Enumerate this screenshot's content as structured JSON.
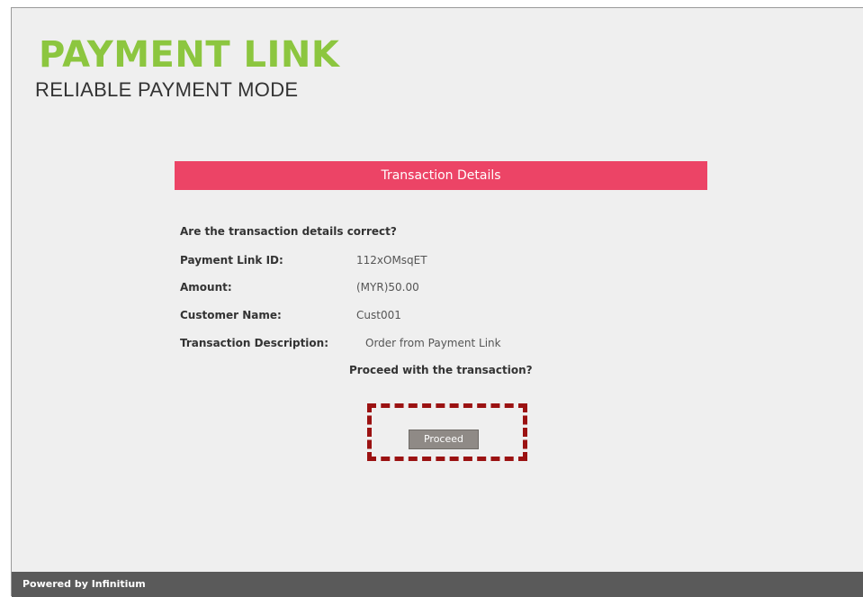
{
  "colors": {
    "brand_green": "#8cc63f",
    "header_pink": "#ec4466",
    "highlight_red": "#9b1212",
    "footer_gray": "#5a5a5a",
    "background": "#efefef"
  },
  "brand": {
    "title": "PAYMENT LINK",
    "subtitle": "RELIABLE PAYMENT MODE"
  },
  "transaction": {
    "header": "Transaction Details",
    "question": "Are the transaction details correct?",
    "rows": [
      {
        "label": "Payment Link ID:",
        "value": "112xOMsqET"
      },
      {
        "label": "Amount:",
        "value": "(MYR)50.00"
      },
      {
        "label": "Customer Name:",
        "value": "Cust001"
      },
      {
        "label": "Transaction Description:",
        "value": "Order from Payment Link"
      }
    ],
    "prompt": "Proceed with the transaction?",
    "proceed_label": "Proceed"
  },
  "footer": {
    "text": "Powered by Infinitium"
  }
}
